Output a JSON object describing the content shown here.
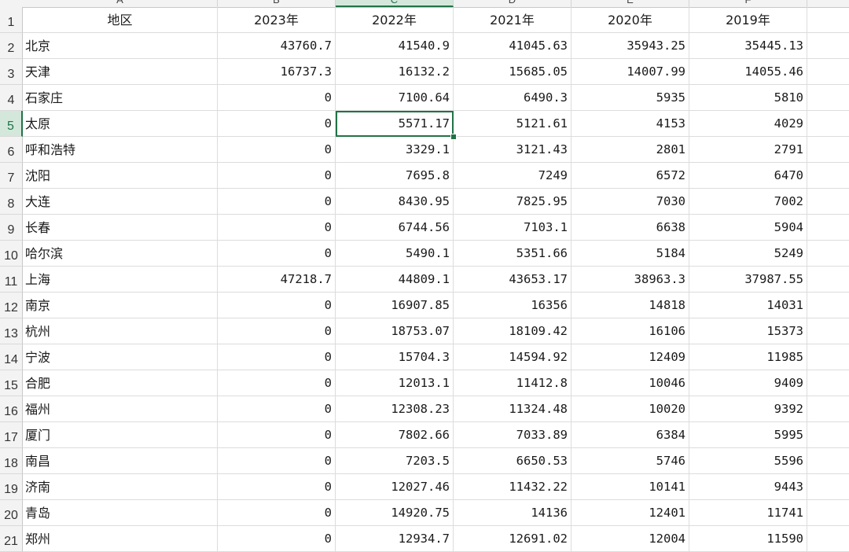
{
  "columns": [
    "A",
    "B",
    "C",
    "D",
    "E",
    "F"
  ],
  "header_row": {
    "row_number": "1",
    "cells": [
      "地区",
      "2023年",
      "2022年",
      "2021年",
      "2020年",
      "2019年"
    ]
  },
  "rows": [
    {
      "row_number": "2",
      "cells": [
        "北京",
        "43760.7",
        "41540.9",
        "41045.63",
        "35943.25",
        "35445.13"
      ]
    },
    {
      "row_number": "3",
      "cells": [
        "天津",
        "16737.3",
        "16132.2",
        "15685.05",
        "14007.99",
        "14055.46"
      ]
    },
    {
      "row_number": "4",
      "cells": [
        "石家庄",
        "0",
        "7100.64",
        "6490.3",
        "5935",
        "5810"
      ]
    },
    {
      "row_number": "5",
      "cells": [
        "太原",
        "0",
        "5571.17",
        "5121.61",
        "4153",
        "4029"
      ]
    },
    {
      "row_number": "6",
      "cells": [
        "呼和浩特",
        "0",
        "3329.1",
        "3121.43",
        "2801",
        "2791"
      ]
    },
    {
      "row_number": "7",
      "cells": [
        "沈阳",
        "0",
        "7695.8",
        "7249",
        "6572",
        "6470"
      ]
    },
    {
      "row_number": "8",
      "cells": [
        "大连",
        "0",
        "8430.95",
        "7825.95",
        "7030",
        "7002"
      ]
    },
    {
      "row_number": "9",
      "cells": [
        "长春",
        "0",
        "6744.56",
        "7103.1",
        "6638",
        "5904"
      ]
    },
    {
      "row_number": "10",
      "cells": [
        "哈尔滨",
        "0",
        "5490.1",
        "5351.66",
        "5184",
        "5249"
      ]
    },
    {
      "row_number": "11",
      "cells": [
        "上海",
        "47218.7",
        "44809.1",
        "43653.17",
        "38963.3",
        "37987.55"
      ]
    },
    {
      "row_number": "12",
      "cells": [
        "南京",
        "0",
        "16907.85",
        "16356",
        "14818",
        "14031"
      ]
    },
    {
      "row_number": "13",
      "cells": [
        "杭州",
        "0",
        "18753.07",
        "18109.42",
        "16106",
        "15373"
      ]
    },
    {
      "row_number": "14",
      "cells": [
        "宁波",
        "0",
        "15704.3",
        "14594.92",
        "12409",
        "11985"
      ]
    },
    {
      "row_number": "15",
      "cells": [
        "合肥",
        "0",
        "12013.1",
        "11412.8",
        "10046",
        "9409"
      ]
    },
    {
      "row_number": "16",
      "cells": [
        "福州",
        "0",
        "12308.23",
        "11324.48",
        "10020",
        "9392"
      ]
    },
    {
      "row_number": "17",
      "cells": [
        "厦门",
        "0",
        "7802.66",
        "7033.89",
        "6384",
        "5995"
      ]
    },
    {
      "row_number": "18",
      "cells": [
        "南昌",
        "0",
        "7203.5",
        "6650.53",
        "5746",
        "5596"
      ]
    },
    {
      "row_number": "19",
      "cells": [
        "济南",
        "0",
        "12027.46",
        "11432.22",
        "10141",
        "9443"
      ]
    },
    {
      "row_number": "20",
      "cells": [
        "青岛",
        "0",
        "14920.75",
        "14136",
        "12401",
        "11741"
      ]
    },
    {
      "row_number": "21",
      "cells": [
        "郑州",
        "0",
        "12934.7",
        "12691.02",
        "12004",
        "11590"
      ]
    }
  ],
  "selection": {
    "column": "C",
    "row_number": "5"
  },
  "colors": {
    "accent": "#217346",
    "header_bg": "#f3f3f3",
    "active_header_bg": "#d3e8db"
  }
}
